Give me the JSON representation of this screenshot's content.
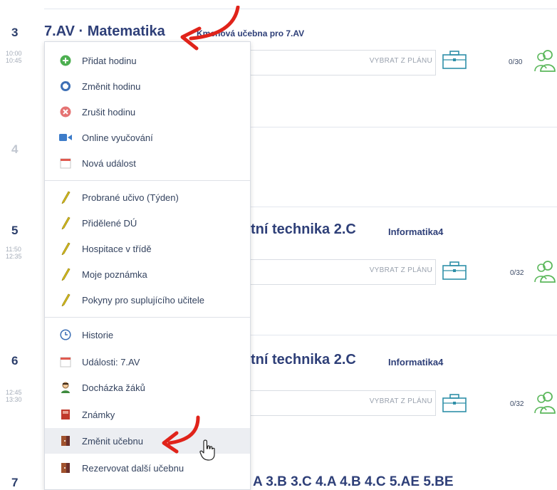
{
  "lessons": [
    {
      "hour": "3",
      "time_start": "10:00",
      "time_end": "10:45",
      "title": "7.AV · Matematika",
      "room_text": "Kmenová učebna pro 7.AV",
      "plan_button": "VYBRAT Z PLÁNU",
      "count": "0/30"
    },
    {
      "hour": "4"
    },
    {
      "hour": "5",
      "time_start": "11:50",
      "time_end": "12:35",
      "title": "tní technika 2.C",
      "room_text": "Informatika4",
      "plan_button": "VYBRAT Z PLÁNU",
      "count": "0/32"
    },
    {
      "hour": "6",
      "time_start": "12:45",
      "time_end": "13:30",
      "title": "tní technika 2.C",
      "room_text": "Informatika4",
      "plan_button": "VYBRAT Z PLÁNU",
      "count": "0/32"
    },
    {
      "hour": "7",
      "title": "A 3.B 3.C 4.A 4.B 4.C 5.AE 5.BE"
    }
  ],
  "menu": {
    "items": [
      {
        "label": "Přidat hodinu",
        "icon": "plus-circle-icon"
      },
      {
        "label": "Změnit hodinu",
        "icon": "refresh-icon"
      },
      {
        "label": "Zrušit hodinu",
        "icon": "cancel-circle-icon"
      },
      {
        "label": "Online vyučování",
        "icon": "video-camera-icon"
      },
      {
        "label": "Nová událost",
        "icon": "calendar-icon"
      },
      {
        "label": "Probrané učivo (Týden)",
        "icon": "pencil-icon"
      },
      {
        "label": "Přidělené DÚ",
        "icon": "pencil-icon"
      },
      {
        "label": "Hospitace v třídě",
        "icon": "pencil-icon"
      },
      {
        "label": "Moje poznámka",
        "icon": "pencil-icon"
      },
      {
        "label": "Pokyny pro suplujícího učitele",
        "icon": "pencil-icon"
      },
      {
        "label": "Historie",
        "icon": "clock-icon"
      },
      {
        "label": "Události: 7.AV",
        "icon": "calendar-icon"
      },
      {
        "label": "Docházka žáků",
        "icon": "student-icon"
      },
      {
        "label": "Známky",
        "icon": "grades-book-icon"
      },
      {
        "label": "Změnit učebnu",
        "icon": "door-icon"
      },
      {
        "label": "Rezervovat další učebnu",
        "icon": "door-icon"
      }
    ]
  },
  "colors": {
    "accent": "#2e3f78",
    "annotation_arrow": "#e0231a",
    "plus": "#4caf50",
    "cancel": "#e57373",
    "refresh": "#3d6fb5",
    "pencil": "#c9b020",
    "door": "#8b3a32",
    "people": "#5cb85c",
    "case": "#2f8fa8"
  }
}
